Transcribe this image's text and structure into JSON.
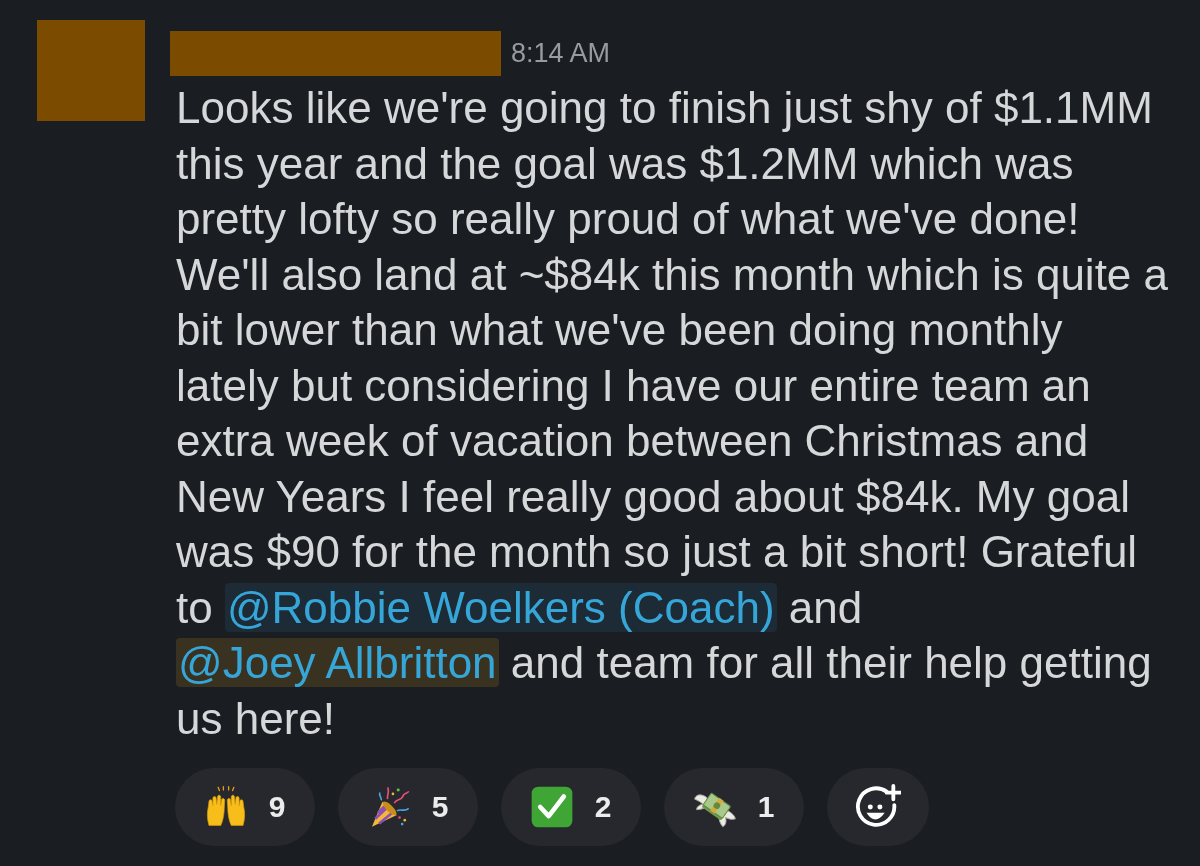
{
  "message": {
    "timestamp": "8:14 AM",
    "segments": [
      {
        "kind": "text",
        "text": "Looks like we're going to finish just shy of $1.1MM this year and the goal was $1.2MM which was pretty lofty so really proud of what we've done! We'll also land at ~$84k this month which is quite a bit lower than what we've been doing monthly lately but considering I have our entire team an extra week of vacation between Christmas and New Years I feel really good about $84k. My goal was $90 for the month so just a bit short! Grateful to "
      },
      {
        "kind": "mention",
        "text": "@Robbie Woelkers (Coach)",
        "highlighted": false
      },
      {
        "kind": "text",
        "text": " and "
      },
      {
        "kind": "mention",
        "text": "@Joey Allbritton",
        "highlighted": true
      },
      {
        "kind": "text",
        "text": " and team for all their help getting us here!"
      }
    ]
  },
  "reactions": [
    {
      "kind": "raised-hands",
      "count": "9",
      "selected": false
    },
    {
      "kind": "party-popper",
      "count": "5",
      "selected": false
    },
    {
      "kind": "check-box",
      "count": "2",
      "selected": false
    },
    {
      "kind": "money-wings",
      "count": "1",
      "selected": false
    }
  ]
}
